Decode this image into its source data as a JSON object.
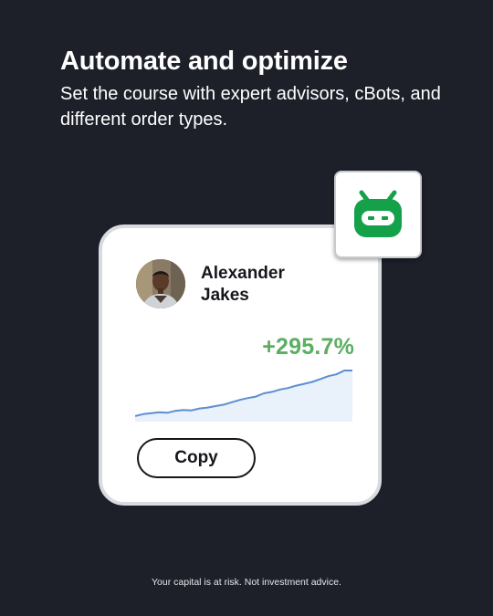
{
  "hero": {
    "title": "Automate and optimize",
    "subtitle": "Set the course with expert advisors, cBots, and different order types."
  },
  "trader_card": {
    "name": "Alexander Jakes",
    "return_value": "+295.7%",
    "copy_button_label": "Copy",
    "return_trend": [
      0.04,
      0.08,
      0.1,
      0.12,
      0.11,
      0.15,
      0.17,
      0.16,
      0.2,
      0.22,
      0.25,
      0.28,
      0.33,
      0.38,
      0.42,
      0.45,
      0.52,
      0.55,
      0.6,
      0.63,
      0.68,
      0.72,
      0.76,
      0.82,
      0.88,
      0.92,
      1.0,
      1.0
    ]
  },
  "bot_badge": {
    "icon": "robot-icon"
  },
  "footer": {
    "disclaimer": "Your capital is at risk. Not investment advice."
  },
  "colors": {
    "background": "#1d2029",
    "accent_green": "#5cae60",
    "bot_green": "#15a04a",
    "chart_line": "#5b8fcf",
    "chart_fill": "#e9f1fb"
  }
}
